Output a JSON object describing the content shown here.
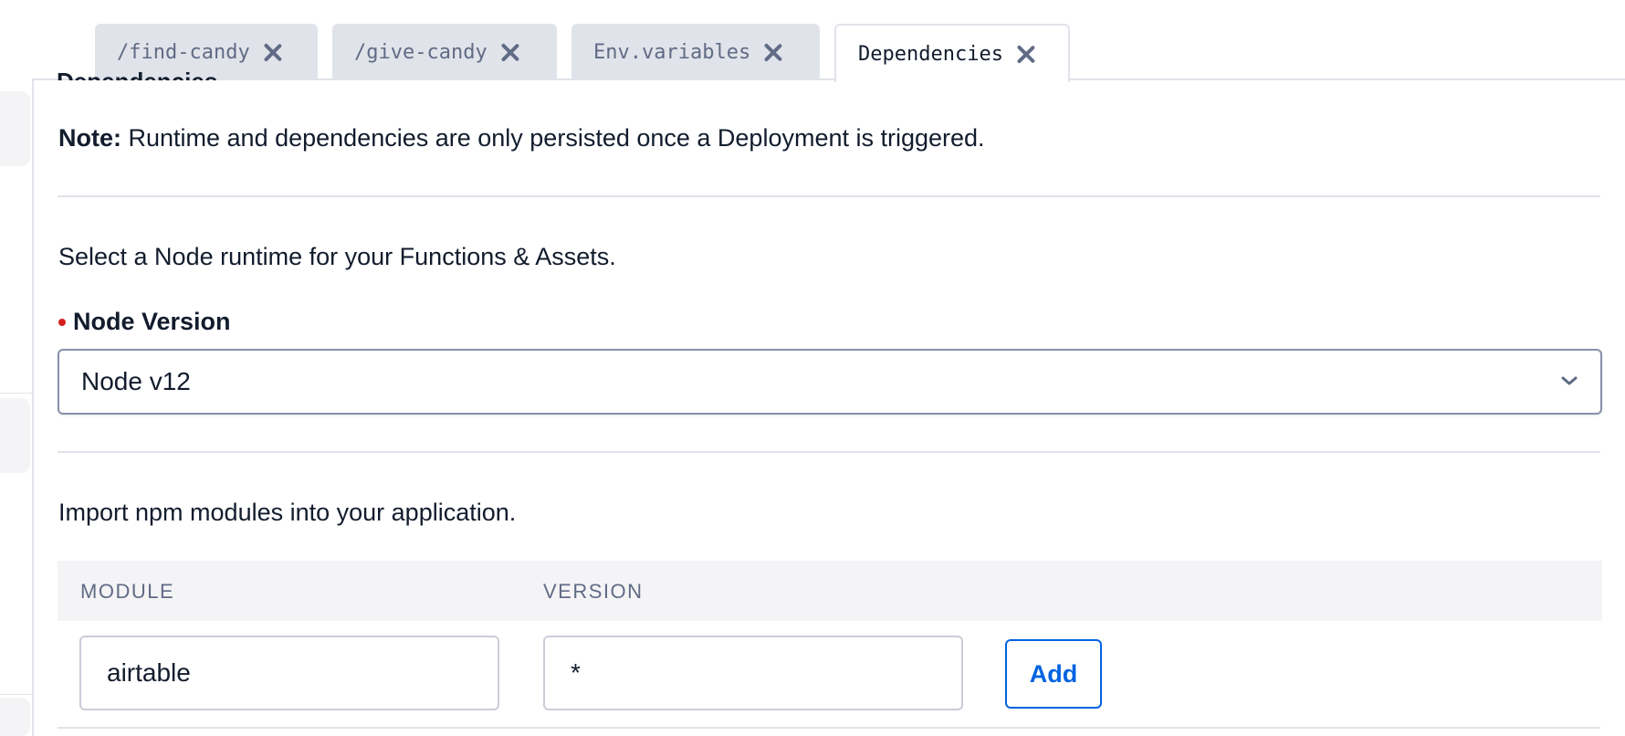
{
  "tabs": [
    {
      "label": "/find-candy",
      "active": false
    },
    {
      "label": "/give-candy",
      "active": false
    },
    {
      "label": "Env.variables",
      "active": false
    },
    {
      "label": "Dependencies",
      "active": true
    }
  ],
  "panel": {
    "clipped_heading": "Dependencies",
    "note_prefix": "Note:",
    "note_text": " Runtime and dependencies are only persisted once a Deployment is triggered.",
    "runtime_description": "Select a Node runtime for your Functions & Assets.",
    "node_version_label": "Node Version",
    "node_version_value": "Node v12",
    "modules_description": "Import npm modules into your application.",
    "table": {
      "module_header": "MODULE",
      "version_header": "VERSION"
    },
    "module_input_value": "airtable",
    "version_input_value": "*",
    "add_label": "Add"
  },
  "colors": {
    "accent": "#0263e0",
    "required": "#d61f1f",
    "muted_text": "#606b85",
    "border": "#e1e3ea"
  },
  "icons": {
    "tab_close": "close-icon",
    "select_open": "chevron-down-icon"
  }
}
